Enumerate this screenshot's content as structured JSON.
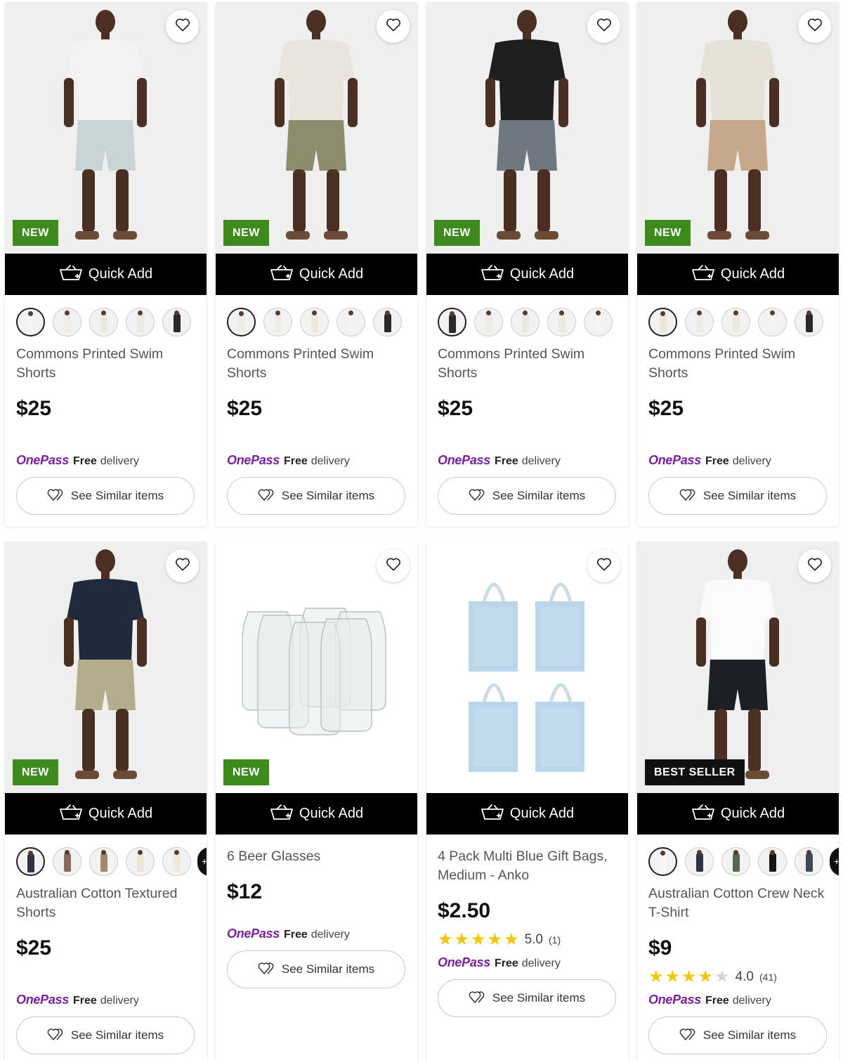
{
  "colors": {
    "badge_new": "#3d8b1c",
    "badge_best": "#111111",
    "onepass": "#7b1fa2",
    "star": "#f6c600"
  },
  "products": [
    {
      "name": "Commons Printed Swim Shorts",
      "price": "$25",
      "badge": "NEW",
      "badge_type": "new",
      "quick_add": "Quick Add",
      "swatches": [
        "#f4f4f2",
        "#efede6",
        "#ebe8de",
        "#eaeadf",
        "#2a2a2a"
      ],
      "photo": {
        "top": "#f3f3f1",
        "bottom": "#c8d4d6",
        "style": "person"
      },
      "onepass": {
        "logo": "OnePass",
        "free": "Free",
        "delivery": "delivery"
      },
      "similar": "See Similar items"
    },
    {
      "name": "Commons Printed Swim Shorts",
      "price": "$25",
      "badge": "NEW",
      "badge_type": "new",
      "quick_add": "Quick Add",
      "swatches": [
        "#ecebe4",
        "#ecebe4",
        "#ebe8de",
        "#f4f4f2",
        "#2a2a2a"
      ],
      "photo": {
        "top": "#e8e5dc",
        "bottom": "#8d8c6c",
        "style": "person"
      },
      "onepass": {
        "logo": "OnePass",
        "free": "Free",
        "delivery": "delivery"
      },
      "similar": "See Similar items"
    },
    {
      "name": "Commons Printed Swim Shorts",
      "price": "$25",
      "badge": "NEW",
      "badge_type": "new",
      "quick_add": "Quick Add",
      "swatches": [
        "#2a2a2a",
        "#ecebe4",
        "#ebe8de",
        "#eaeadf",
        "#f4f4f2"
      ],
      "photo": {
        "top": "#1e1e1e",
        "bottom": "#6f7880",
        "style": "person"
      },
      "onepass": {
        "logo": "OnePass",
        "free": "Free",
        "delivery": "delivery"
      },
      "similar": "See Similar items"
    },
    {
      "name": "Commons Printed Swim Shorts",
      "price": "$25",
      "badge": "NEW",
      "badge_type": "new",
      "quick_add": "Quick Add",
      "swatches": [
        "#ebe8de",
        "#ecebe4",
        "#eaeadf",
        "#f4f4f2",
        "#2a2a2a"
      ],
      "photo": {
        "top": "#e6e2d8",
        "bottom": "#c7a88c",
        "style": "person"
      },
      "onepass": {
        "logo": "OnePass",
        "free": "Free",
        "delivery": "delivery"
      },
      "similar": "See Similar items"
    },
    {
      "name": "Australian Cotton Textured Shorts",
      "price": "$25",
      "badge": "NEW",
      "badge_type": "new",
      "quick_add": "Quick Add",
      "swatches": [
        "#2d3340",
        "#8a6a58",
        "#a3886a",
        "#ece6d8",
        "#f2e8da"
      ],
      "more": true,
      "photo": {
        "top": "#1f2a3b",
        "bottom": "#b4ad8c",
        "style": "person"
      },
      "onepass": {
        "logo": "OnePass",
        "free": "Free",
        "delivery": "delivery"
      },
      "similar": "See Similar items"
    },
    {
      "name": "6 Beer Glasses",
      "price": "$12",
      "badge": "NEW",
      "badge_type": "new",
      "quick_add": "Quick Add",
      "swatches": [],
      "photo": {
        "style": "glasses"
      },
      "onepass": {
        "logo": "OnePass",
        "free": "Free",
        "delivery": "delivery"
      },
      "similar": "See Similar items"
    },
    {
      "name": "4 Pack Multi Blue Gift Bags, Medium - Anko",
      "price": "$2.50",
      "badge": "",
      "badge_type": "",
      "quick_add": "Quick Add",
      "swatches": [],
      "rating": {
        "stars": 5,
        "value": "5.0",
        "count": "(1)"
      },
      "photo": {
        "style": "bags"
      },
      "onepass": {
        "logo": "OnePass",
        "free": "Free",
        "delivery": "delivery"
      },
      "similar": "See Similar items"
    },
    {
      "name": "Australian Cotton Crew Neck T-Shirt",
      "price": "$9",
      "badge": "BEST SELLER",
      "badge_type": "best",
      "quick_add": "Quick Add",
      "swatches": [
        "#f6f6f6",
        "#2b3347",
        "#55684d",
        "#151515",
        "#3e4a55"
      ],
      "more": true,
      "rating": {
        "stars": 4,
        "value": "4.0",
        "count": "(41)"
      },
      "photo": {
        "top": "#fafafa",
        "bottom": "#1d1f26",
        "style": "person"
      },
      "onepass": {
        "logo": "OnePass",
        "free": "Free",
        "delivery": "delivery"
      },
      "similar": "See Similar items"
    }
  ]
}
